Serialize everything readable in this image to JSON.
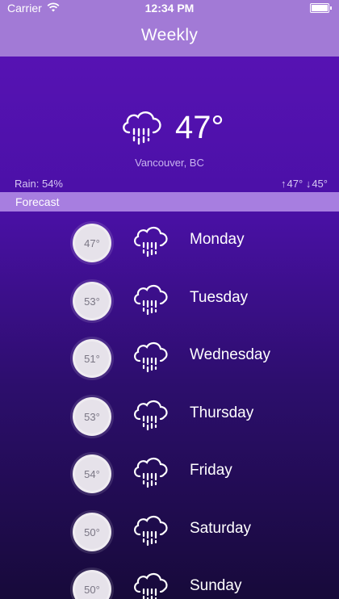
{
  "status_bar": {
    "carrier": "Carrier",
    "time": "12:34 PM"
  },
  "nav": {
    "title": "Weekly"
  },
  "current": {
    "icon": "rain-cloud-icon",
    "temperature": "47°",
    "location": "Vancouver, BC",
    "rain": "Rain: 54%",
    "high": "47°",
    "low": "45°"
  },
  "forecast": {
    "header": "Forecast",
    "days": [
      {
        "temp": "47°",
        "day": "Monday",
        "icon": "rain-cloud-icon"
      },
      {
        "temp": "53°",
        "day": "Tuesday",
        "icon": "rain-cloud-icon"
      },
      {
        "temp": "51°",
        "day": "Wednesday",
        "icon": "rain-cloud-icon"
      },
      {
        "temp": "53°",
        "day": "Thursday",
        "icon": "rain-cloud-icon"
      },
      {
        "temp": "54°",
        "day": "Friday",
        "icon": "rain-cloud-icon"
      },
      {
        "temp": "50°",
        "day": "Saturday",
        "icon": "rain-cloud-icon"
      },
      {
        "temp": "50°",
        "day": "Sunday",
        "icon": "rain-cloud-icon"
      }
    ]
  },
  "colors": {
    "nav_bar": "#a27ad6",
    "forecast_bar": "#a77ee0",
    "gradient_top": "#5b13b8",
    "gradient_bottom": "#170a3a"
  }
}
